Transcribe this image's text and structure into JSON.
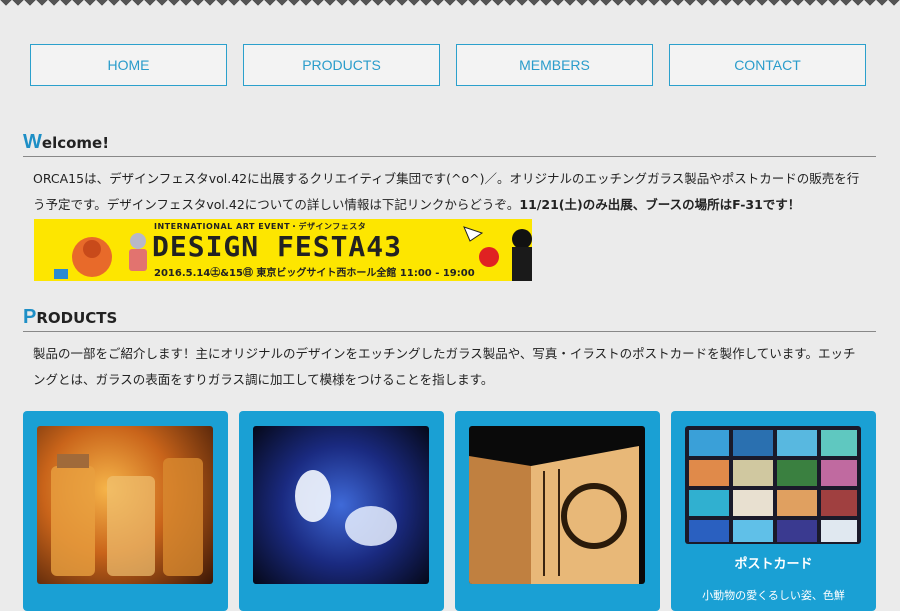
{
  "nav": {
    "home": "HOME",
    "products": "PRODUCTS",
    "members": "MEMBERS",
    "contact": "CONTACT"
  },
  "welcome": {
    "initial": "W",
    "rest": "elcome!",
    "text": "ORCA15は、デザインフェスタvol.42に出展するクリエイティブ集団です(^o^)／。オリジナルのエッチングガラス製品やポストカードの販売を行う予定です。デザインフェスタvol.42についての詳しい情報は下記リンクからどうぞ。",
    "highlight": "11/21(土)のみ出展、ブースの場所はF-31です！"
  },
  "banner": {
    "top": "INTERNATIONAL ART EVENT・デザインフェスタ",
    "title": "DESIGN FESTA43",
    "date": "2016.5.14㊏&15㊐ 東京ビッグサイト西ホール全館 11:00 - 19:00"
  },
  "products": {
    "initial": "P",
    "rest": "RODUCTS",
    "text": "製品の一部をご紹介します！主にオリジナルのデザインをエッチングしたガラス製品や、写真・イラストのポストカードを製作しています。エッチングとは、ガラスの表面をすりガラス調に加工して模様をつけることを指します。"
  },
  "cards": [
    {
      "caption": ""
    },
    {
      "caption": ""
    },
    {
      "caption": ""
    },
    {
      "caption": "ポストカード",
      "subtext": "小動物の愛くるしい姿、色鮮"
    }
  ],
  "colors": {
    "accent": "#1aa0d4",
    "nav_text": "#2a9ccb",
    "background": "#ebebeb",
    "banner": "#fde600"
  }
}
